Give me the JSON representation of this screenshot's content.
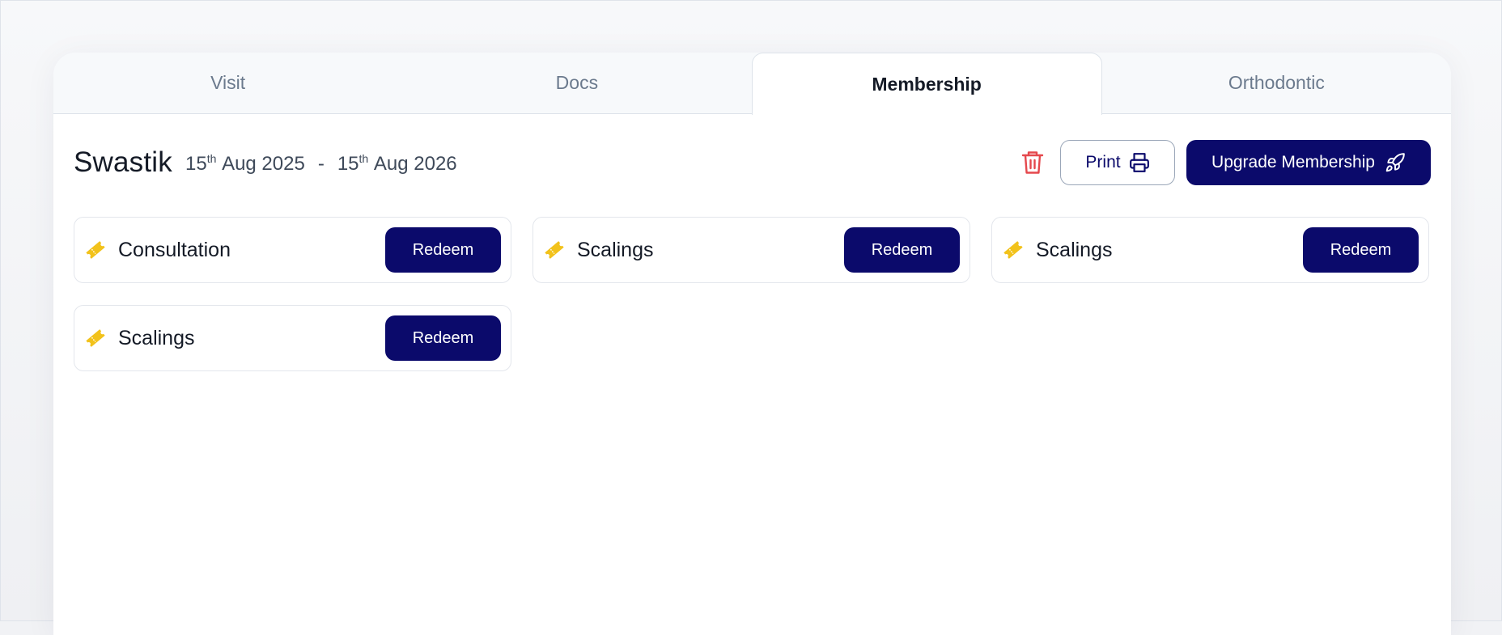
{
  "tabs": [
    {
      "label": "Visit",
      "active": false
    },
    {
      "label": "Docs",
      "active": false
    },
    {
      "label": "Membership",
      "active": true
    },
    {
      "label": "Orthodontic",
      "active": false
    }
  ],
  "membership": {
    "name": "Swastik",
    "start": {
      "day": "15",
      "suffix": "th",
      "rest": "Aug 2025"
    },
    "separator": "-",
    "end": {
      "day": "15",
      "suffix": "th",
      "rest": "Aug 2026"
    }
  },
  "actions": {
    "delete_icon": "trash-icon",
    "print_label": "Print",
    "print_icon": "printer-icon",
    "upgrade_label": "Upgrade Membership",
    "upgrade_icon": "rocket-icon"
  },
  "benefits": [
    {
      "label": "Consultation",
      "button": "Redeem",
      "icon": "ticket-icon"
    },
    {
      "label": "Scalings",
      "button": "Redeem",
      "icon": "ticket-icon"
    },
    {
      "label": "Scalings",
      "button": "Redeem",
      "icon": "ticket-icon"
    },
    {
      "label": "Scalings",
      "button": "Redeem",
      "icon": "ticket-icon"
    }
  ],
  "colors": {
    "primary": "#0b0a6b",
    "ticket": "#f2c21b",
    "danger": "#e5484d",
    "text": "#141a26",
    "muted": "#6b7a8d"
  }
}
